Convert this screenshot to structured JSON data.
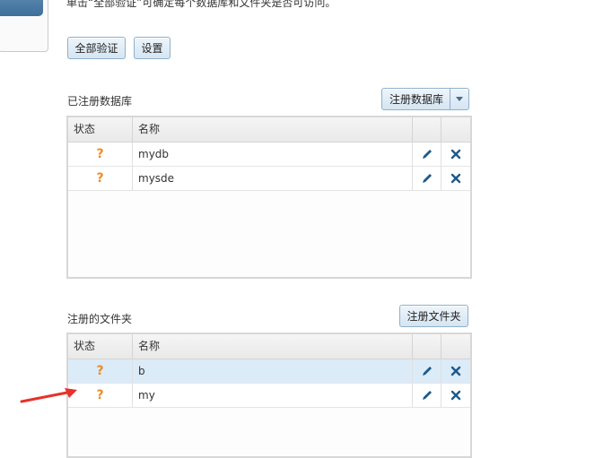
{
  "intro_text": "单击“全部验证”可确定每个数据库和文件夹是否可访问。",
  "buttons": {
    "validate_all": "全部验证",
    "settings": "设置",
    "register_db": "注册数据库",
    "register_folder": "注册文件夹"
  },
  "databases": {
    "label": "已注册数据库",
    "columns": {
      "status": "状态",
      "name": "名称"
    },
    "rows": [
      {
        "status": "?",
        "name": "mydb"
      },
      {
        "status": "?",
        "name": "mysde"
      }
    ]
  },
  "folders": {
    "label": "注册的文件夹",
    "columns": {
      "status": "状态",
      "name": "名称"
    },
    "rows": [
      {
        "status": "?",
        "name": "b",
        "selected": true
      },
      {
        "status": "?",
        "name": "my",
        "selected": false
      }
    ]
  },
  "colors": {
    "status_unknown": "#f08a24",
    "action_icon": "#1f5a8a",
    "annotation_arrow": "#e8312a"
  }
}
